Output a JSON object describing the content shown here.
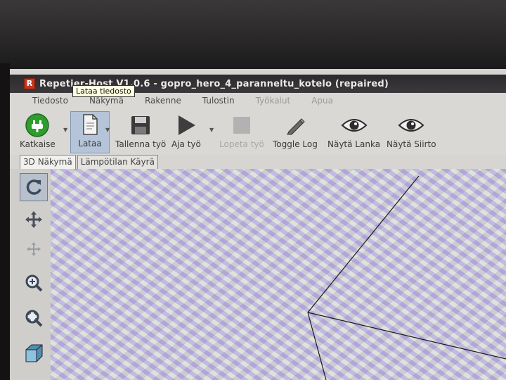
{
  "window": {
    "title": "Repetier-Host V1.0.6 - gopro_hero_4_paranneltu_kotelo (repaired)",
    "logo_letter": "R"
  },
  "menu": {
    "items": [
      {
        "label": "Tiedosto",
        "enabled": true
      },
      {
        "label": "Näkymä",
        "enabled": true
      },
      {
        "label": "Rakenne",
        "enabled": true
      },
      {
        "label": "Tulostin",
        "enabled": true
      },
      {
        "label": "Työkalut",
        "enabled": false
      },
      {
        "label": "Apua",
        "enabled": false
      }
    ]
  },
  "toolbar": {
    "connect_label": "Katkaise",
    "load_label": "Lataa",
    "save_label": "Tallenna työ",
    "run_label": "Aja työ",
    "stop_label": "Lopeta työ",
    "toggle_log_label": "Toggle Log",
    "show_filament_label": "Näytä Lanka",
    "show_travel_label": "Näytä Siirto",
    "tooltip": "Lataa tiedosto"
  },
  "tabs": [
    {
      "label": "3D Näkymä",
      "active": true
    },
    {
      "label": "Lämpötilan Käyrä",
      "active": false
    }
  ],
  "colors": {
    "connect_green": "#2e9d2e",
    "active_tool": "#b5c4d8"
  }
}
